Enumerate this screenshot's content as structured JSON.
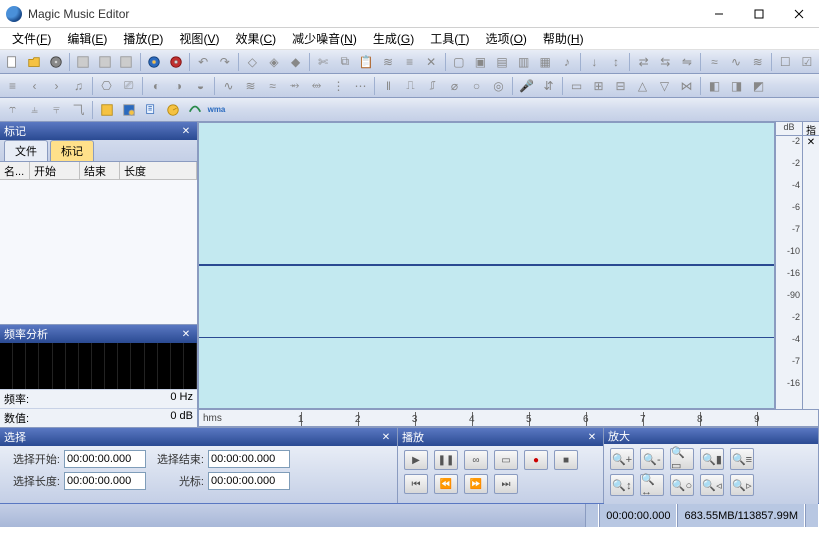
{
  "title": "Magic Music Editor",
  "menu": [
    {
      "label": "文件",
      "key": "F"
    },
    {
      "label": "编辑",
      "key": "E"
    },
    {
      "label": "播放",
      "key": "P"
    },
    {
      "label": "视图",
      "key": "V"
    },
    {
      "label": "效果",
      "key": "C"
    },
    {
      "label": "减少噪音",
      "key": "N"
    },
    {
      "label": "生成",
      "key": "G"
    },
    {
      "label": "工具",
      "key": "T"
    },
    {
      "label": "选项",
      "key": "O"
    },
    {
      "label": "帮助",
      "key": "H"
    }
  ],
  "markers": {
    "panel_title": "标记",
    "tabs": {
      "file": "文件",
      "markers": "标记"
    },
    "columns": {
      "name": "名...",
      "start": "开始",
      "end": "结束",
      "length": "长度"
    }
  },
  "freq": {
    "panel_title": "频率分析",
    "freq_label": "频率:",
    "freq_value": "0 Hz",
    "value_label": "数值:",
    "value_value": "0 dB"
  },
  "db_scale": {
    "header": "dB",
    "ticks": [
      -2,
      -2,
      -4,
      -6,
      -7,
      -10,
      -16,
      -90,
      -2,
      -4,
      -7,
      -16
    ]
  },
  "time_ruler": {
    "unit": "hms",
    "ticks": [
      1,
      2,
      3,
      4,
      5,
      6,
      7,
      8,
      9
    ]
  },
  "selection": {
    "panel_title": "选择",
    "labels": {
      "start": "选择开始:",
      "end": "选择结束:",
      "length": "选择长度:",
      "cursor": "光标:"
    },
    "values": {
      "start": "00:00:00.000",
      "end": "00:00:00.000",
      "length": "00:00:00.000",
      "cursor": "00:00:00.000"
    }
  },
  "playback": {
    "panel_title": "播放"
  },
  "zoom": {
    "panel_title": "放大"
  },
  "status": {
    "time": "00:00:00.000",
    "memory": "683.55MB/113857.99M"
  },
  "right_header": "指"
}
